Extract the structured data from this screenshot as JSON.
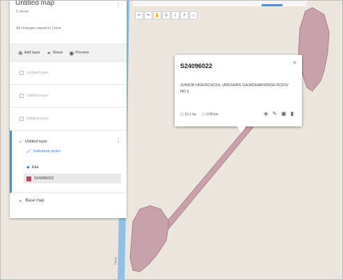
{
  "panel": {
    "map_title": "Untitled map",
    "views": "5 views",
    "saved_status": "All changes saved in Drive",
    "menu_icon": "more-vert-icon",
    "actions": [
      {
        "icon": "add-layer-icon",
        "label": "Add layer"
      },
      {
        "icon": "share-icon",
        "label": "Share"
      },
      {
        "icon": "preview-icon",
        "label": "Preview"
      }
    ],
    "empty_layers": [
      {
        "label": "Untitled layer"
      },
      {
        "label": "Untitled layer"
      },
      {
        "label": "Untitled layer"
      }
    ],
    "active_layer": {
      "label": "Untitled layer",
      "style_link": "Individual styles",
      "items": [
        {
          "label": "Etia",
          "icon": "pin-icon"
        },
        {
          "label": "S24096022",
          "icon": "polygon-icon"
        }
      ]
    },
    "base_map": "Base map"
  },
  "toolbar": {
    "tools": [
      "undo-icon",
      "redo-icon",
      "hand-icon",
      "marker-icon",
      "line-icon",
      "route-icon",
      "ruler-icon"
    ]
  },
  "popup": {
    "title": "S24096022",
    "description": "JUNIOR HIGHSCHOOL URESHRG GAJADHARSINGH RODIV NO 2",
    "area": "10.1 ha",
    "length": "0.08 km",
    "tools": [
      "style-icon",
      "edit-icon",
      "photo-icon",
      "delete-icon"
    ]
  },
  "colors": {
    "polygon_fill": "#c7a1ab",
    "polygon_stroke": "#b07a88",
    "river": "#8ec1e3",
    "map_bg": "#ebe7df",
    "accent": "#4a90d9"
  }
}
